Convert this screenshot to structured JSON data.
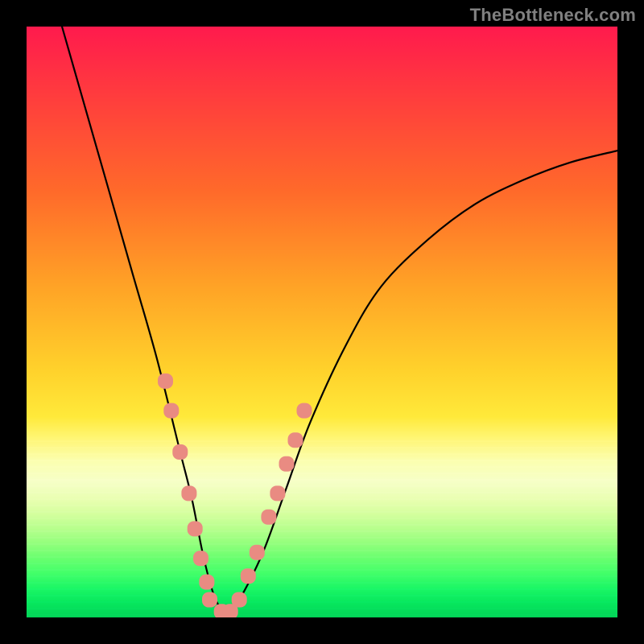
{
  "watermark": "TheBottleneck.com",
  "chart_data": {
    "type": "line",
    "title": "",
    "xlabel": "",
    "ylabel": "",
    "xlim": [
      0,
      100
    ],
    "ylim": [
      0,
      100
    ],
    "grid": false,
    "legend": false,
    "series": [
      {
        "name": "bottleneck-curve",
        "x": [
          6,
          10,
          14,
          18,
          22,
          26,
          28,
          30,
          32,
          34,
          36,
          40,
          44,
          48,
          54,
          60,
          68,
          76,
          84,
          92,
          100
        ],
        "y": [
          100,
          86,
          72,
          58,
          44,
          28,
          20,
          10,
          3,
          1,
          3,
          11,
          22,
          33,
          46,
          56,
          64,
          70,
          74,
          77,
          79
        ]
      }
    ],
    "markers": {
      "name": "highlighted-points",
      "color": "#e98b82",
      "points": [
        {
          "x": 23.5,
          "y": 40
        },
        {
          "x": 24.5,
          "y": 35
        },
        {
          "x": 26.0,
          "y": 28
        },
        {
          "x": 27.5,
          "y": 21
        },
        {
          "x": 28.5,
          "y": 15
        },
        {
          "x": 29.5,
          "y": 10
        },
        {
          "x": 30.5,
          "y": 6
        },
        {
          "x": 31.0,
          "y": 3
        },
        {
          "x": 33.0,
          "y": 1
        },
        {
          "x": 34.5,
          "y": 1
        },
        {
          "x": 36.0,
          "y": 3
        },
        {
          "x": 37.5,
          "y": 7
        },
        {
          "x": 39.0,
          "y": 11
        },
        {
          "x": 41.0,
          "y": 17
        },
        {
          "x": 42.5,
          "y": 21
        },
        {
          "x": 44.0,
          "y": 26
        },
        {
          "x": 45.5,
          "y": 30
        },
        {
          "x": 47.0,
          "y": 35
        }
      ]
    },
    "background": {
      "type": "vertical-gradient",
      "stops": [
        {
          "pos": 0,
          "color": "#ff1a4d"
        },
        {
          "pos": 66,
          "color": "#ffe93a"
        },
        {
          "pos": 100,
          "color": "#03d457"
        }
      ]
    }
  }
}
